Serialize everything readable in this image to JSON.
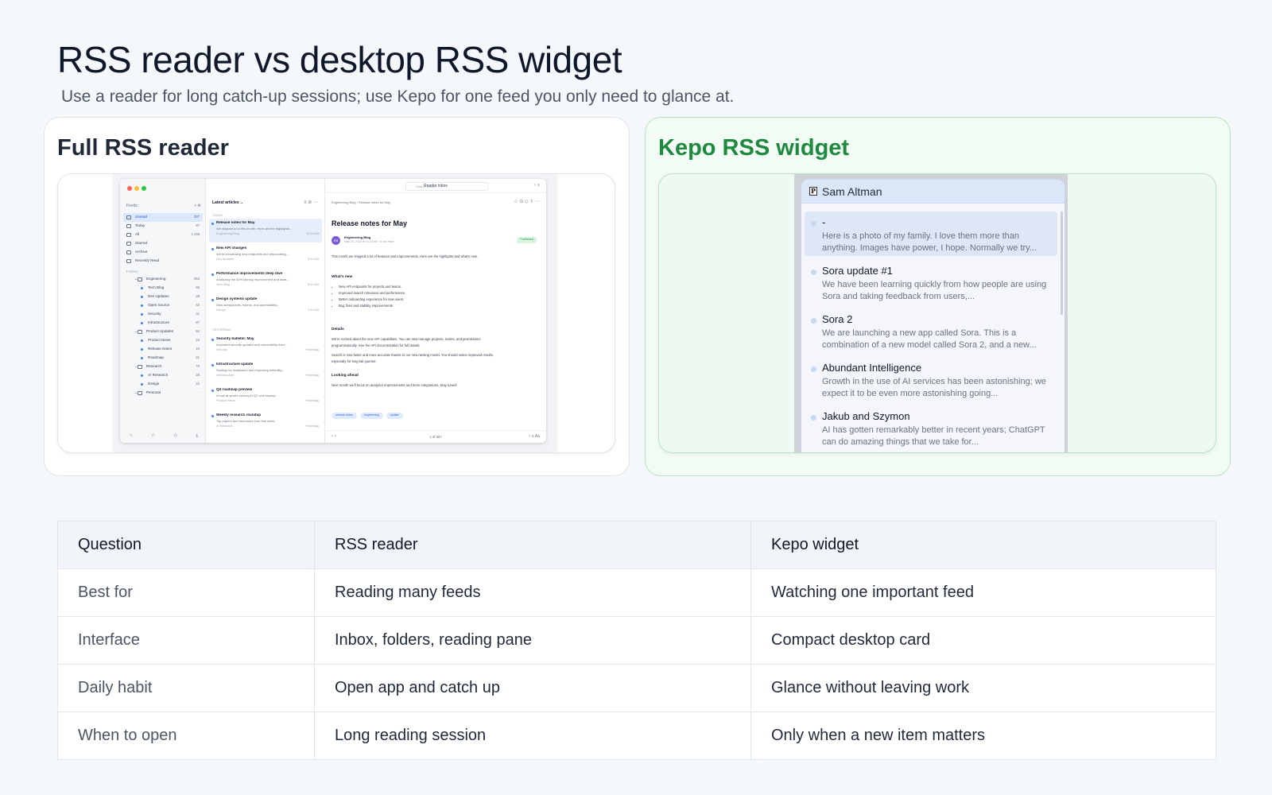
{
  "page": {
    "title": "RSS reader vs desktop RSS widget",
    "subtitle": "Use a reader for long catch-up sessions; use Kepo for one feed you only need to glance at."
  },
  "left_panel": {
    "title": "Full RSS reader",
    "reader": {
      "window_title": "Reader inbox",
      "search_placeholder": "Search articles",
      "feeds_label": "Feeds",
      "nav": [
        {
          "label": "Unread",
          "count": "387"
        },
        {
          "label": "Today",
          "count": "87"
        },
        {
          "label": "All",
          "count": "1,245"
        },
        {
          "label": "Starred",
          "count": ""
        },
        {
          "label": "Archive",
          "count": ""
        },
        {
          "label": "Recently Read",
          "count": ""
        }
      ],
      "folders_label": "Folders",
      "folders": [
        {
          "label": "Engineering",
          "count": "253",
          "level": 1
        },
        {
          "label": "Tech Blog",
          "count": "65",
          "level": 2
        },
        {
          "label": "Dev Updates",
          "count": "38",
          "level": 2
        },
        {
          "label": "Open Source",
          "count": "42",
          "level": 2
        },
        {
          "label": "Security",
          "count": "31",
          "level": 2
        },
        {
          "label": "Infrastructure",
          "count": "87",
          "level": 2
        },
        {
          "label": "Product Updates",
          "count": "64",
          "level": 1
        },
        {
          "label": "Product News",
          "count": "24",
          "level": 2
        },
        {
          "label": "Release Notes",
          "count": "19",
          "level": 2
        },
        {
          "label": "Roadmap",
          "count": "21",
          "level": 2
        },
        {
          "label": "Research",
          "count": "70",
          "level": 1
        },
        {
          "label": "AI Research",
          "count": "28",
          "level": 2
        },
        {
          "label": "Design",
          "count": "22",
          "level": 2
        },
        {
          "label": "Personal",
          "count": "-",
          "level": 1
        }
      ],
      "list_header": "Latest articles ⌄",
      "group_today": "TODAY",
      "group_yesterday": "YESTERDAY",
      "articles": [
        {
          "title": "Release notes for May",
          "snippet": "We shipped a lot this month. Here are the highlights...",
          "source": "Engineering Blog",
          "time": "10:24 AM"
        },
        {
          "title": "New API changes",
          "snippet": "We're introducing new endpoints and deprecating...",
          "source": "Dev Updates",
          "time": "9:15 AM"
        },
        {
          "title": "Performance improvements deep dive",
          "snippet": "Analyzing the 30% latency improvement and what...",
          "source": "Tech Blog",
          "time": "8:02 AM"
        },
        {
          "title": "Design systems update",
          "snippet": "New components, tokens, and accessibility...",
          "source": "Design",
          "time": "7:45 AM"
        },
        {
          "title": "Security bulletin: May",
          "snippet": "Important security updates and vulnerability fixes...",
          "source": "Security",
          "time": "Yesterday"
        },
        {
          "title": "Infrastructure update",
          "snippet": "Scaling our databases and improving reliability...",
          "source": "Infrastructure",
          "time": "Yesterday"
        },
        {
          "title": "Q2 roadmap preview",
          "snippet": "A look at what's coming in Q2 and beyond.",
          "source": "Product News",
          "time": "Yesterday"
        },
        {
          "title": "Weekly research roundup",
          "snippet": "Top papers and resources from this week.",
          "source": "AI Research",
          "time": "Yesterday"
        }
      ],
      "article": {
        "breadcrumb": "Engineering Blog  ›  Release notes for May",
        "title": "Release notes for May",
        "avatar": "EB",
        "author": "Engineering Blog",
        "meta": "May 24, 2025 at 10:24 AM  ·  5 min read",
        "badge": "Published",
        "intro": "This month we shipped a lot of features and improvements. Here are the highlights and what's new.",
        "whats_new_heading": "What's new",
        "bullets": [
          "New API endpoints for projects and teams.",
          "Improved search relevance and performance.",
          "Better onboarding experience for new users.",
          "Bug fixes and stability improvements."
        ],
        "details_heading": "Details",
        "details_1": "We're excited about the new API capabilities. You can now manage projects, invites, and permissions programmatically. See the API documentation for full details.",
        "details_2": "Search is now faster and more accurate thanks to our new ranking model. You should notice improved results, especially for long-tail queries.",
        "looking_heading": "Looking ahead",
        "looking_text": "Next month we'll focus on analytics improvements and more integrations. Stay tuned!",
        "tags": [
          "release-notes",
          "engineering",
          "update"
        ],
        "pager": "1 of 387"
      }
    }
  },
  "right_panel": {
    "title": "Kepo RSS widget",
    "widget": {
      "feed_logo": "P",
      "feed_name": "Sam Altman",
      "items": [
        {
          "title": "-",
          "snippet": "Here is a photo of my family. I love them more than anything. Images have power, I hope. Normally we try..."
        },
        {
          "title": "Sora update #1",
          "snippet": "We have been learning quickly from how people are using Sora and taking feedback from users,..."
        },
        {
          "title": "Sora 2",
          "snippet": "We are launching a new app called Sora. This is a combination of a new model called Sora 2, and a new..."
        },
        {
          "title": "Abundant Intelligence",
          "snippet": "Growth in the use of AI services has been astonishing; we expect it to be even more astonishing going..."
        },
        {
          "title": "Jakub and Szymon",
          "snippet": "AI has gotten remarkably better in recent years; ChatGPT can do amazing things that we take for..."
        }
      ]
    }
  },
  "comparison": {
    "headers": [
      "Question",
      "RSS reader",
      "Kepo widget"
    ],
    "rows": [
      [
        "Best for",
        "Reading many feeds",
        "Watching one important feed"
      ],
      [
        "Interface",
        "Inbox, folders, reading pane",
        "Compact desktop card"
      ],
      [
        "Daily habit",
        "Open app and catch up",
        "Glance without leaving work"
      ],
      [
        "When to open",
        "Long reading session",
        "Only when a new item matters"
      ]
    ]
  },
  "colors": {
    "accent_green": "#1e8a40",
    "accent_blue": "#2563eb",
    "mac_red": "#ff5f57",
    "mac_yellow": "#febc2e",
    "mac_green": "#28c840"
  }
}
